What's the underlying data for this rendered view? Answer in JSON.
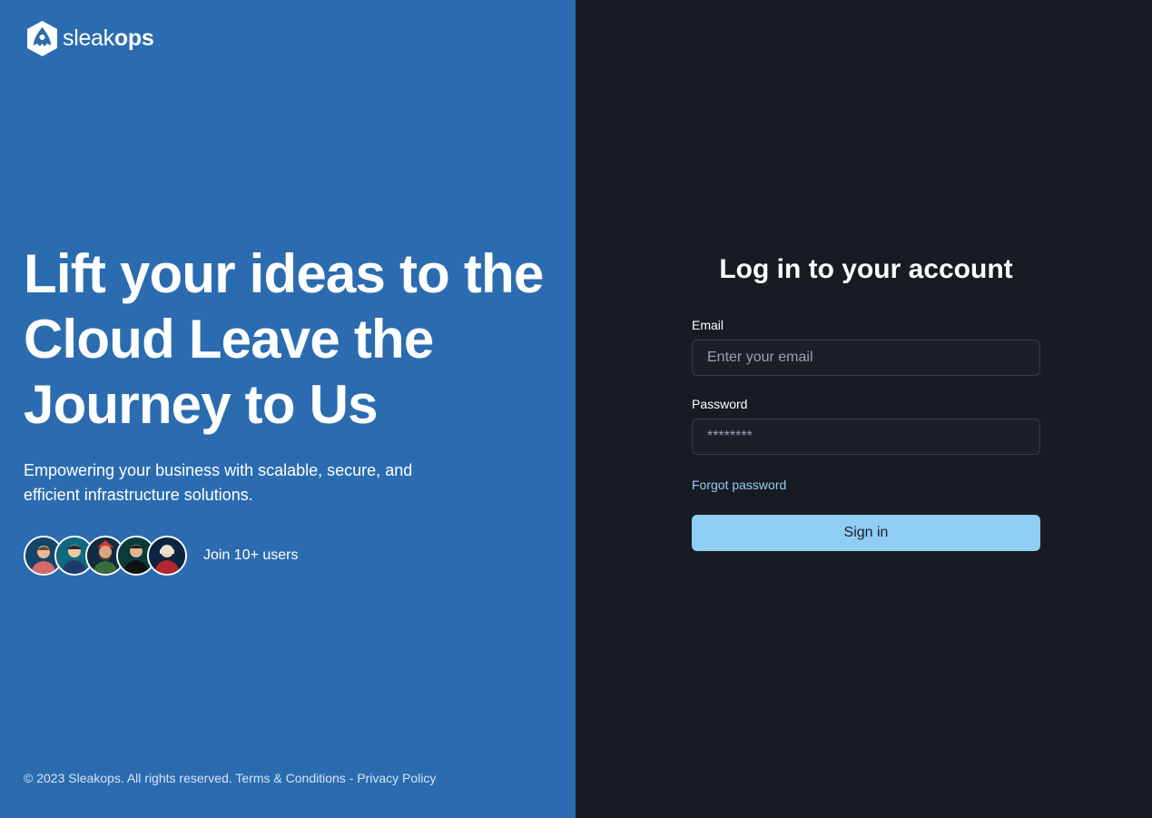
{
  "brand": {
    "name_light": "sleak",
    "name_bold": "ops",
    "logo_icon": "sleakops-logo-icon"
  },
  "hero": {
    "title": "Lift your ideas to the Cloud Leave the Journey to Us",
    "subtitle": "Empowering your business with scalable, secure, and efficient infrastructure solutions."
  },
  "users": {
    "label": "Join 10+ users",
    "avatars": [
      "avatar-1",
      "avatar-2",
      "avatar-3",
      "avatar-4",
      "avatar-5"
    ]
  },
  "footer": {
    "copyright": "© 2023 Sleakops. All rights reserved.",
    "terms": "Terms & Conditions",
    "separator": "-",
    "privacy": "Privacy Policy"
  },
  "login": {
    "title": "Log in to your account",
    "email_label": "Email",
    "email_placeholder": "Enter your email",
    "email_value": "",
    "password_label": "Password",
    "password_placeholder": "********",
    "forgot_label": "Forgot password",
    "signin_label": "Sign in"
  },
  "colors": {
    "left_panel": "#2b6cb0",
    "right_panel": "#191b23",
    "accent": "#90cdf4"
  }
}
